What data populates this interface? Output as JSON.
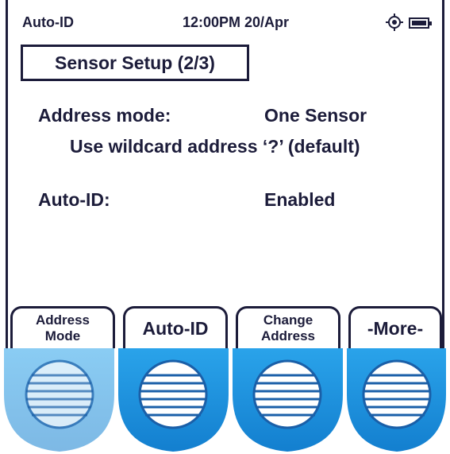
{
  "status_bar": {
    "mode": "Auto-ID",
    "time_date": "12:00PM 20/Apr",
    "gps_icon": "gps-target-icon",
    "battery_icon": "battery-full-icon"
  },
  "screen_title": "Sensor Setup (2/3)",
  "settings": {
    "address_mode_label": "Address mode:",
    "address_mode_value": "One Sensor",
    "address_mode_note": "Use wildcard address ‘?’ (default)",
    "auto_id_label": "Auto-ID:",
    "auto_id_value": "Enabled"
  },
  "softkeys": [
    {
      "line1": "Address",
      "line2": "Mode"
    },
    {
      "label": "Auto-ID"
    },
    {
      "line1": "Change",
      "line2": "Address"
    },
    {
      "label": "-More-"
    }
  ],
  "colors": {
    "text": "#1c1c3a",
    "key_blue": "#1a8fd8",
    "key_stripe": "#1a5fa8"
  }
}
